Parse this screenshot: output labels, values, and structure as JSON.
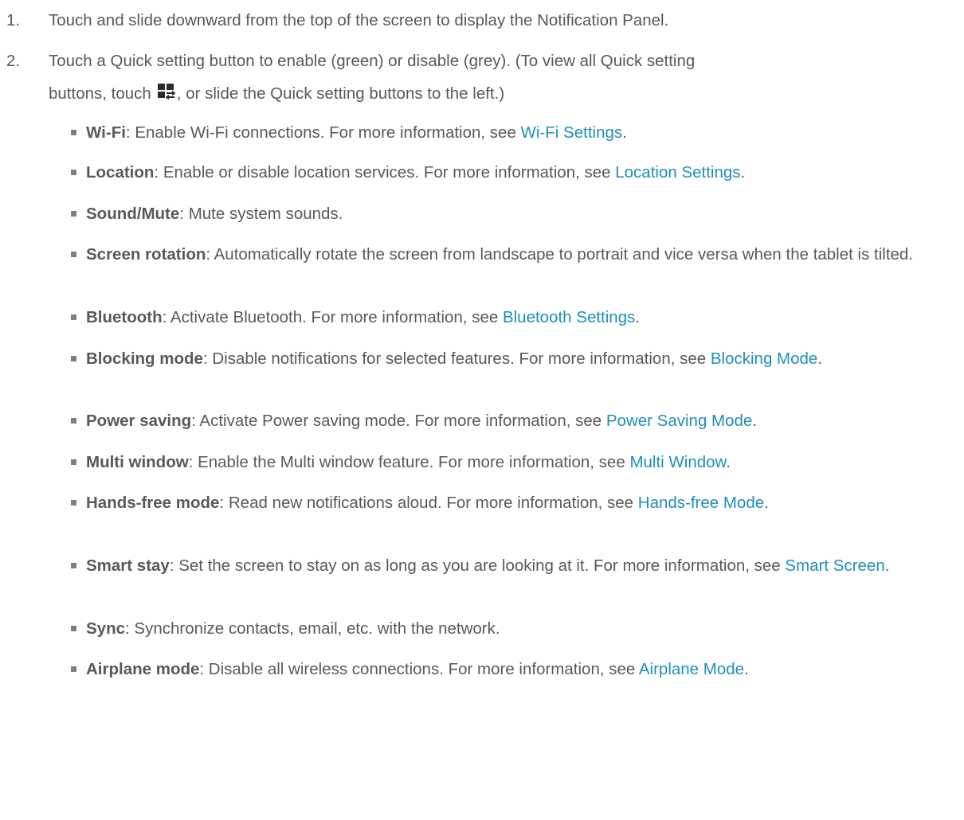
{
  "steps": [
    {
      "number": "1.",
      "text": "Touch and slide downward from the top of the screen to display the Notification Panel."
    },
    {
      "number": "2.",
      "text_line1": "Touch a Quick setting button to enable (green) or disable (grey). (To view all Quick setting",
      "text_line2_before": "buttons, touch",
      "icon": "quick-settings-grid-icon",
      "text_line2_after": ", or slide the Quick setting buttons to the left.)"
    }
  ],
  "bullets": [
    {
      "term": "Wi-Fi",
      "text": ": Enable Wi-Fi connections. For more information, see ",
      "link": "Wi-Fi Settings",
      "after": "."
    },
    {
      "term": "Location",
      "text": ": Enable or disable location services. For more information, see ",
      "link": "Location Settings",
      "after": "."
    },
    {
      "term": "Sound/Mute",
      "text": ": Mute system sounds.",
      "link": "",
      "after": ""
    },
    {
      "term": "Screen rotation",
      "text": ": Automatically rotate the screen from landscape to portrait and vice versa when the tablet is tilted.",
      "link": "",
      "after": ""
    },
    {
      "term": "Bluetooth",
      "text": ": Activate Bluetooth. For more information, see ",
      "link": "Bluetooth Settings",
      "after": "."
    },
    {
      "term": "Blocking mode",
      "text": ": Disable notifications for selected features. For more information, see ",
      "link": "Blocking Mode",
      "after": "."
    },
    {
      "term": "Power saving",
      "text": ": Activate Power saving mode. For more information, see ",
      "link": "Power Saving Mode",
      "after": "."
    },
    {
      "term": "Multi window",
      "text": ": Enable the Multi window feature. For more information, see ",
      "link": "Multi Window",
      "after": "."
    },
    {
      "term": "Hands-free mode",
      "text": ": Read new notifications aloud. For more information, see ",
      "link": "Hands-free Mode",
      "after": "."
    },
    {
      "term": "Smart stay",
      "text": ": Set the screen to stay on as long as you are looking at it. For more information, see ",
      "link": "Smart Screen",
      "after": "."
    },
    {
      "term": "Sync",
      "text": ": Synchronize contacts, email, etc. with the network.",
      "link": "",
      "after": ""
    },
    {
      "term": "Airplane mode",
      "text": ": Disable all wireless connections. For more information, see ",
      "link": "Airplane Mode",
      "after": "."
    }
  ],
  "colors": {
    "body_text": "#595959",
    "link": "#1e90b5",
    "bullet": "#7f7f7f"
  }
}
